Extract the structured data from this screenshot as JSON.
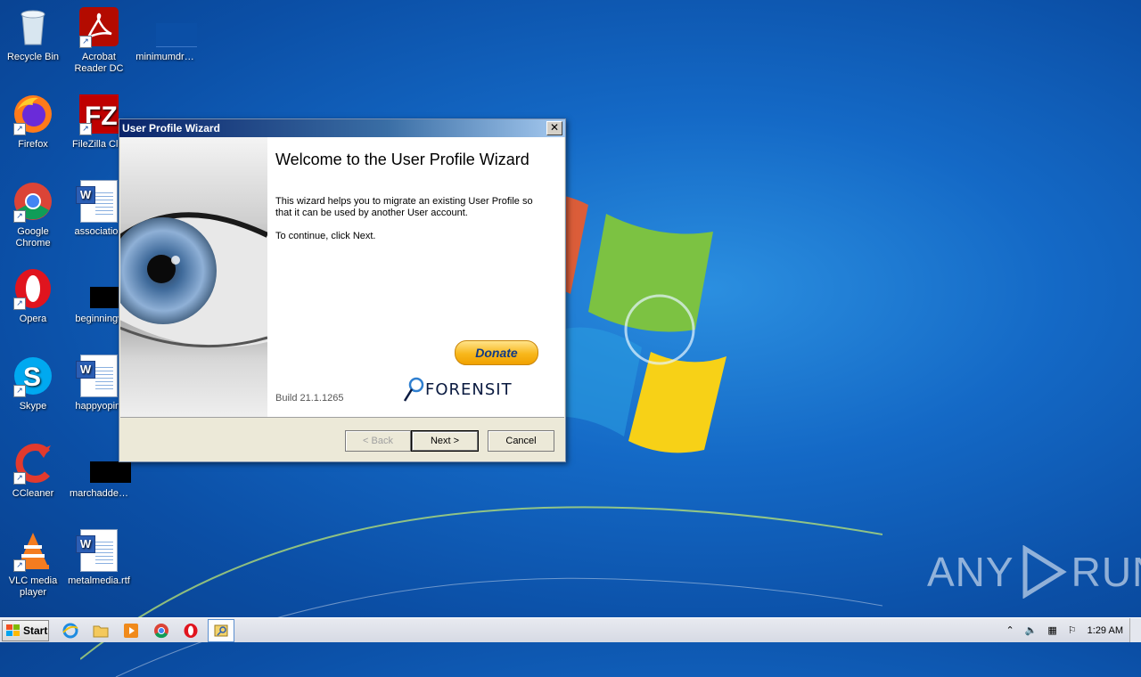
{
  "desktop": {
    "icons": [
      {
        "label": "Recycle Bin"
      },
      {
        "label": "Acrobat Reader DC"
      },
      {
        "label": "minimumdr…"
      },
      {
        "label": "Firefox"
      },
      {
        "label": "FileZilla Clie"
      },
      {
        "label": "Google Chrome"
      },
      {
        "label": "association"
      },
      {
        "label": "Opera"
      },
      {
        "label": "beginningv"
      },
      {
        "label": "Skype"
      },
      {
        "label": "happyopini"
      },
      {
        "label": "CCleaner"
      },
      {
        "label": "marchadde…"
      },
      {
        "label": "VLC media player"
      },
      {
        "label": "metalmedia.rtf"
      }
    ]
  },
  "wizard": {
    "title": "User Profile Wizard",
    "close_label": "✕",
    "heading": "Welcome to the User Profile Wizard",
    "description": "This wizard helps you to migrate an existing User Profile so that it can be used by another User account.",
    "instruction": "To continue, click Next.",
    "donate_label": "Donate",
    "brand": "FORENSIT",
    "build": "Build 21.1.1265",
    "buttons": {
      "back": "< Back",
      "next": "Next >",
      "cancel": "Cancel"
    }
  },
  "taskbar": {
    "start_label": "Start",
    "clock": "1:29 AM"
  },
  "watermark": {
    "text_left": "ANY",
    "text_right": "RUN"
  }
}
